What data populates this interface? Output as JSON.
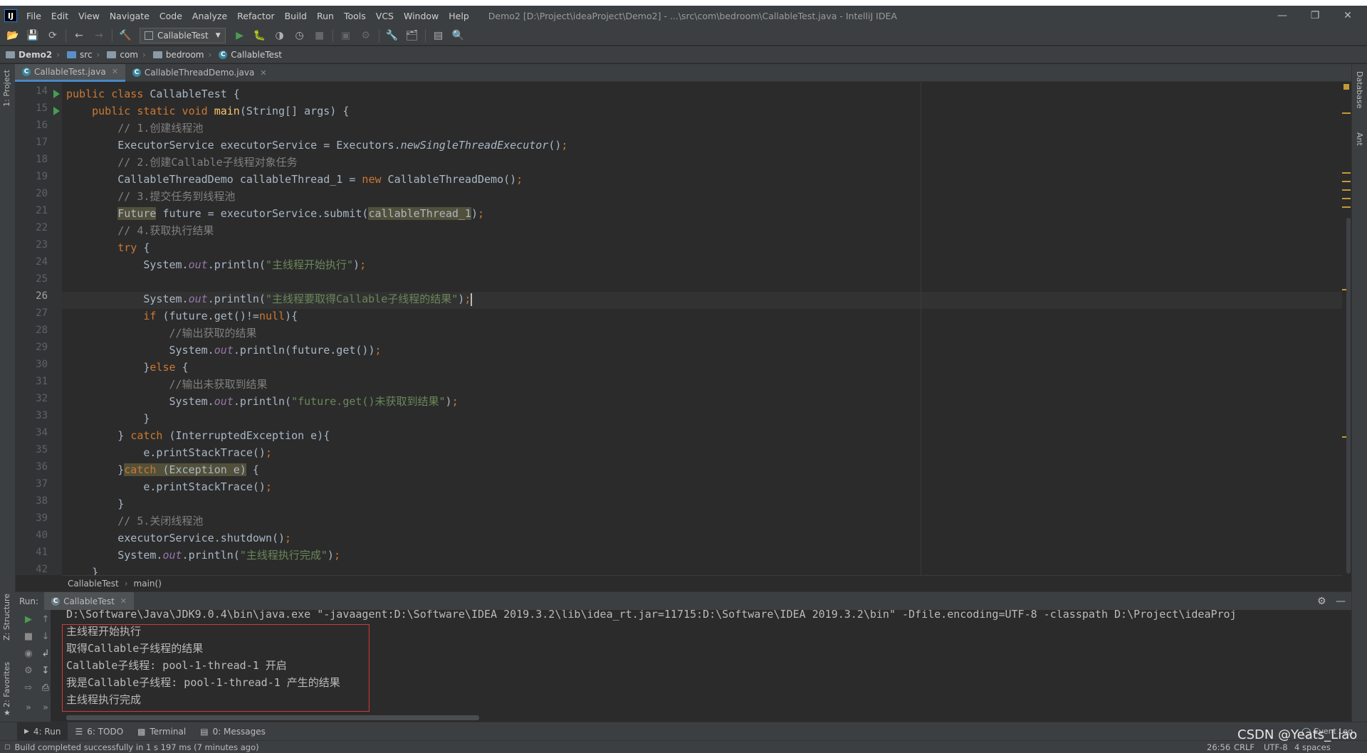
{
  "app": {
    "logo": "IJ",
    "menu": [
      "File",
      "Edit",
      "View",
      "Navigate",
      "Code",
      "Analyze",
      "Refactor",
      "Build",
      "Run",
      "Tools",
      "VCS",
      "Window",
      "Help"
    ],
    "window_title": "Demo2 [D:\\Project\\ideaProject\\Demo2] - ...\\src\\com\\bedroom\\CallableTest.java - IntelliJ IDEA"
  },
  "toolbar": {
    "run_config": "CallableTest"
  },
  "breadcrumb": [
    "Demo2",
    "src",
    "com",
    "bedroom",
    "CallableTest"
  ],
  "tabs": [
    {
      "label": "CallableTest.java",
      "active": true
    },
    {
      "label": "CallableThreadDemo.java",
      "active": false
    }
  ],
  "side_left": {
    "project": "1: Project",
    "structure": "Z: Structure",
    "favorites": "2: Favorites"
  },
  "side_right": {
    "database": "Database",
    "ant": "Ant"
  },
  "editor": {
    "line_numbers": [
      "14",
      "15",
      "16",
      "17",
      "18",
      "19",
      "20",
      "21",
      "22",
      "23",
      "24",
      "25",
      "26",
      "27",
      "28",
      "29",
      "30",
      "31",
      "32",
      "33",
      "34",
      "35",
      "36",
      "37",
      "38",
      "39",
      "40",
      "41",
      "42"
    ],
    "current_line": "26",
    "code_breadcrumb": [
      "CallableTest",
      "main()"
    ]
  },
  "run_panel": {
    "label": "Run:",
    "tab": "CallableTest",
    "command_line": "D:\\Software\\Java\\JDK9.0.4\\bin\\java.exe \"-javaagent:D:\\Software\\IDEA 2019.3.2\\lib\\idea_rt.jar=11715:D:\\Software\\IDEA 2019.3.2\\bin\" -Dfile.encoding=UTF-8 -classpath D:\\Project\\ideaProj",
    "output": [
      "主线程开始执行",
      "取得Callable子线程的结果",
      "Callable子线程: pool-1-thread-1 开启",
      "我是Callable子线程: pool-1-thread-1 产生的结果",
      "主线程执行完成"
    ]
  },
  "tool_windows": [
    {
      "label": "4: Run",
      "active": true
    },
    {
      "label": "6: TODO",
      "active": false
    },
    {
      "label": "Terminal",
      "active": false
    },
    {
      "label": "0: Messages",
      "active": false
    }
  ],
  "event_log": "Event Log",
  "status": {
    "message": "Build completed successfully in 1 s 197 ms (7 minutes ago)",
    "position": "26:56",
    "line_sep": "CRLF",
    "encoding": "UTF-8",
    "indent": "4 spaces"
  },
  "watermark": "CSDN @Yeats_Liao"
}
